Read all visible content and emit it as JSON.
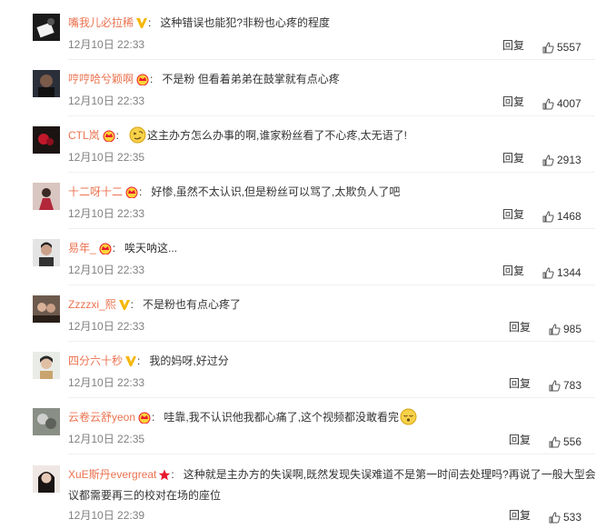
{
  "colors": {
    "username": "#eb7350",
    "time": "#808080",
    "text": "#333333",
    "vip": "#f6b70a",
    "crown": "#e8182f",
    "star": "#e8182f"
  },
  "reply_label": "回复",
  "comments": [
    {
      "username": "嘴我儿必拉稀",
      "badge": "vip-v-icon",
      "text": "这种错误也能犯?非粉也心疼的程度",
      "time": "12月10日 22:33",
      "likes": "5557"
    },
    {
      "username": "哼哼哈兮颖啊",
      "badge": "crown-icon",
      "text": "不是粉 但看着弟弟在鼓掌就有点心疼",
      "time": "12月10日 22:33",
      "likes": "4007"
    },
    {
      "username": "CTL岚",
      "badge": "crown-icon",
      "emoji": "dizzy-emoji-icon",
      "text": "这主办方怎么办事的啊,谁家粉丝看了不心疼,太无语了!",
      "time": "12月10日 22:35",
      "likes": "2913"
    },
    {
      "username": "十二呀十二",
      "badge": "crown-icon",
      "text": "好惨,虽然不太认识,但是粉丝可以骂了,太欺负人了吧",
      "time": "12月10日 22:33",
      "likes": "1468"
    },
    {
      "username": "易年_",
      "badge": "crown-icon",
      "text": "唉天呐这...",
      "time": "12月10日 22:33",
      "likes": "1344"
    },
    {
      "username": "Zzzzxi_熙",
      "badge": "vip-v-icon",
      "text": "不是粉也有点心疼了",
      "time": "12月10日 22:33",
      "likes": "985"
    },
    {
      "username": "四分六十秒",
      "badge": "vip-v-icon",
      "text": "我的妈呀,好过分",
      "time": "12月10日 22:33",
      "likes": "783"
    },
    {
      "username": "云卷云舒yeon",
      "badge": "crown-icon",
      "text": "哇靠,我不认识他我都心痛了,这个视频都没敢看完",
      "trailing_emoji": "sleepy-emoji-icon",
      "time": "12月10日 22:35",
      "likes": "556"
    },
    {
      "username": "XuE斯丹evergreat",
      "badge": "red-star-icon",
      "text": "这种就是主办方的失误啊,既然发现失误难道不是第一时间去处理吗?再说了一般大型会议都需要再三的校对在场的座位",
      "time": "12月10日 22:39",
      "likes": "533"
    }
  ]
}
